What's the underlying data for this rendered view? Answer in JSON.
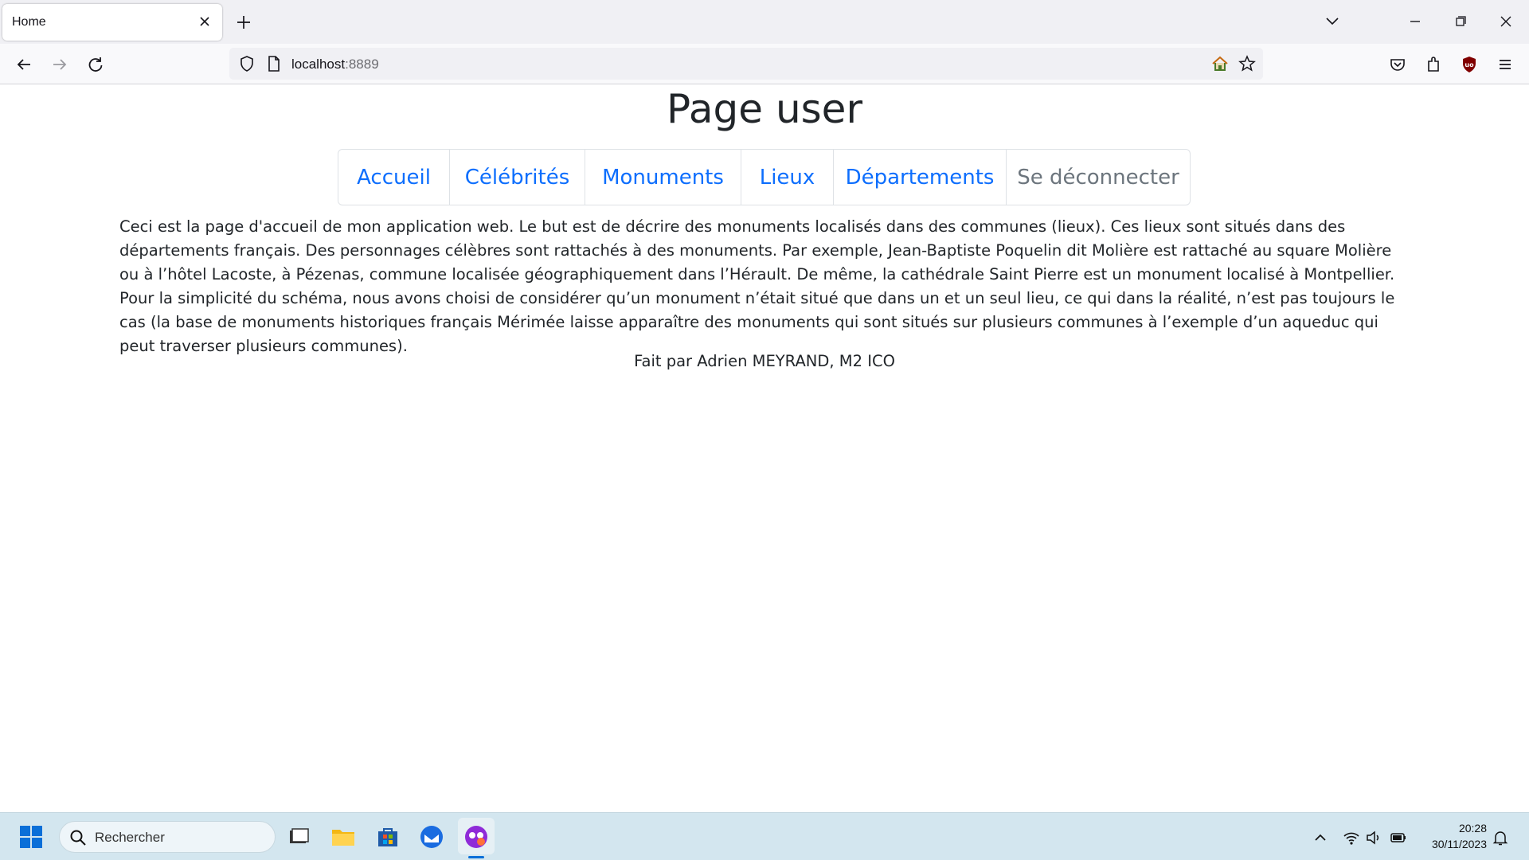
{
  "browser": {
    "tab_title": "Home",
    "url_host": "localhost",
    "url_port": ":8889"
  },
  "page": {
    "title": "Page user",
    "nav": [
      {
        "label": "Accueil"
      },
      {
        "label": "Célébrités"
      },
      {
        "label": "Monuments"
      },
      {
        "label": "Lieux"
      },
      {
        "label": "Départements"
      },
      {
        "label": "Se déconnecter"
      }
    ],
    "intro": "Ceci est la page d'accueil de mon application web. Le but est de décrire des monuments localisés dans des communes (lieux). Ces lieux sont situés dans des départements français. Des personnages célèbres sont rattachés à des monuments. Par exemple, Jean-Baptiste Poquelin dit Molière est rattaché au square Molière ou à l’hôtel Lacoste, à Pézenas, commune localisée géographiquement dans l’Hérault. De même, la cathédrale Saint Pierre est un monument localisé à Montpellier. Pour la simplicité du schéma, nous avons choisi de considérer qu’un monument n’était situé que dans un et un seul lieu, ce qui dans la réalité, n’est pas toujours le cas (la base de monuments historiques français Mérimée laisse apparaître des monuments qui sont situés sur plusieurs communes à l’exemple d’un aqueduc qui peut traverser plusieurs communes).",
    "footer": "Fait par Adrien MEYRAND, M2 ICO"
  },
  "taskbar": {
    "search_placeholder": "Rechercher",
    "time": "20:28",
    "date": "30/11/2023"
  },
  "colors": {
    "link": "#0d6efd",
    "muted": "#6c757d",
    "text": "#212529"
  }
}
